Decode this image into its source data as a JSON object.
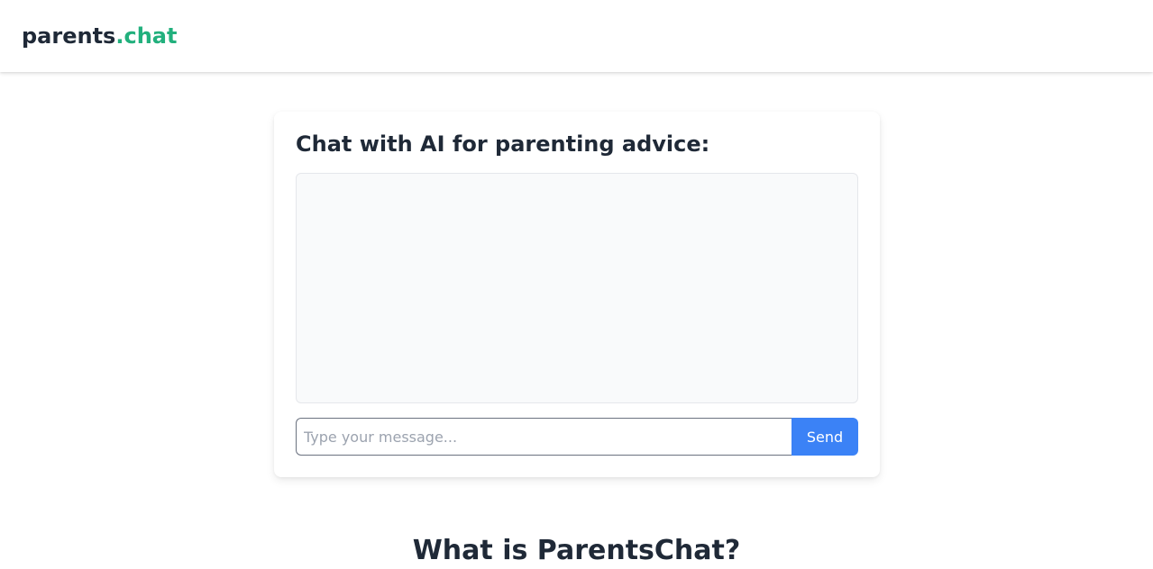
{
  "header": {
    "logo_main": "parents",
    "logo_accent": ".chat",
    "accent_color": "#22b07d"
  },
  "chat": {
    "title": "Chat with AI for parenting advice:",
    "messages": [],
    "input_placeholder": "Type your message...",
    "input_value": "",
    "send_label": "Send",
    "send_color": "#3b82f6"
  },
  "about": {
    "title": "What is ParentsChat?"
  }
}
